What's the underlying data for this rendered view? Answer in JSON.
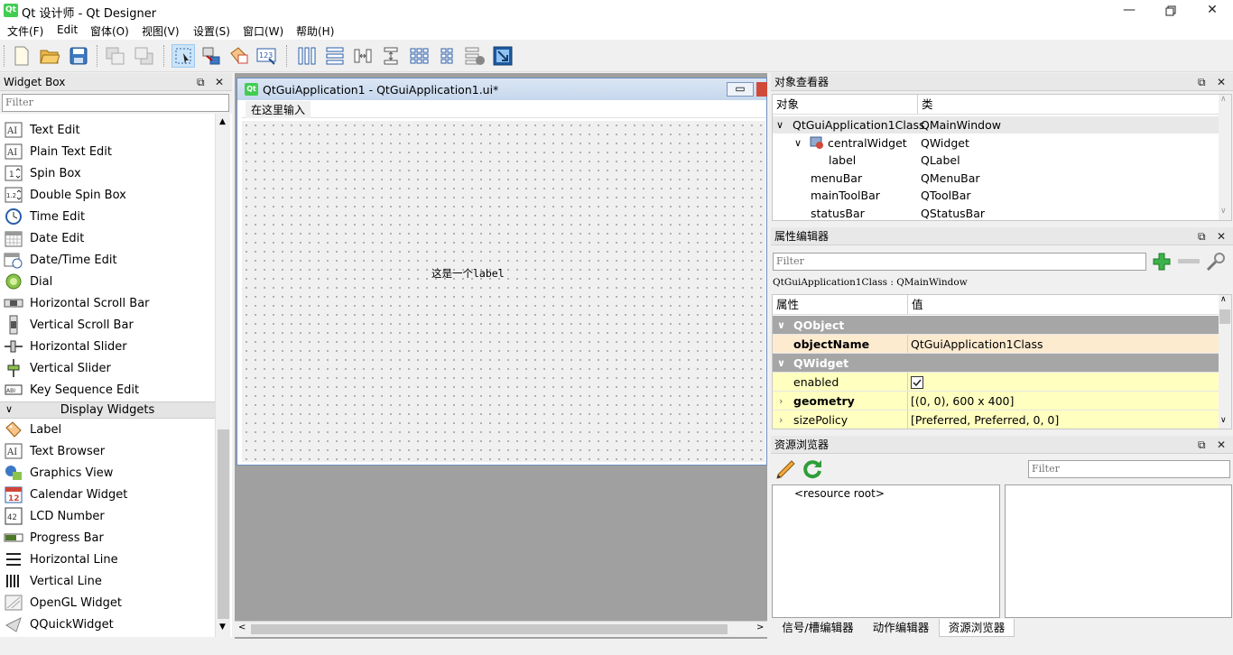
{
  "window": {
    "title": "Qt 设计师 - Qt Designer",
    "logo": "Qt"
  },
  "menubar": [
    "文件(F)",
    "Edit",
    "窗体(O)",
    "视图(V)",
    "设置(S)",
    "窗口(W)",
    "帮助(H)"
  ],
  "widget_box": {
    "title": "Widget Box",
    "filter_placeholder": "Filter",
    "items_top": [
      {
        "label": "Text Edit",
        "icon": "text-edit-icon"
      },
      {
        "label": "Plain Text Edit",
        "icon": "plain-text-edit-icon"
      },
      {
        "label": "Spin Box",
        "icon": "spin-box-icon"
      },
      {
        "label": "Double Spin Box",
        "icon": "double-spin-box-icon"
      },
      {
        "label": "Time Edit",
        "icon": "clock-icon"
      },
      {
        "label": "Date Edit",
        "icon": "calendar-grid-icon"
      },
      {
        "label": "Date/Time Edit",
        "icon": "calendar-clock-icon"
      },
      {
        "label": "Dial",
        "icon": "dial-icon"
      },
      {
        "label": "Horizontal Scroll Bar",
        "icon": "hscrollbar-icon"
      },
      {
        "label": "Vertical Scroll Bar",
        "icon": "vscrollbar-icon"
      },
      {
        "label": "Horizontal Slider",
        "icon": "hslider-icon"
      },
      {
        "label": "Vertical Slider",
        "icon": "vslider-icon"
      },
      {
        "label": "Key Sequence Edit",
        "icon": "key-sequence-icon"
      }
    ],
    "category": "Display Widgets",
    "items_bottom": [
      {
        "label": "Label",
        "icon": "label-tag-icon"
      },
      {
        "label": "Text Browser",
        "icon": "text-browser-icon"
      },
      {
        "label": "Graphics View",
        "icon": "graphics-view-icon"
      },
      {
        "label": "Calendar Widget",
        "icon": "calendar-icon",
        "badge": "12"
      },
      {
        "label": "LCD Number",
        "icon": "lcd-number-icon",
        "badge": "42"
      },
      {
        "label": "Progress Bar",
        "icon": "progress-bar-icon"
      },
      {
        "label": "Horizontal Line",
        "icon": "hline-icon"
      },
      {
        "label": "Vertical Line",
        "icon": "vline-icon"
      },
      {
        "label": "OpenGL Widget",
        "icon": "opengl-icon"
      },
      {
        "label": "QQuickWidget",
        "icon": "quick-widget-icon"
      }
    ]
  },
  "form_window": {
    "title": "QtGuiApplication1 - QtGuiApplication1.ui*",
    "logo": "Qt",
    "menu_placeholder": "在这里输入",
    "label_text": "这是一个label"
  },
  "object_inspector": {
    "title": "对象查看器",
    "headers": [
      "对象",
      "类"
    ],
    "rows": [
      {
        "object": "QtGuiApplication1Class",
        "class": "QMainWindow",
        "level": 0,
        "expander": "∨"
      },
      {
        "object": "centralWidget",
        "class": "QWidget",
        "level": 1,
        "expander": "∨"
      },
      {
        "object": "label",
        "class": "QLabel",
        "level": 2,
        "expander": ""
      },
      {
        "object": "menuBar",
        "class": "QMenuBar",
        "level": 1,
        "expander": ""
      },
      {
        "object": "mainToolBar",
        "class": "QToolBar",
        "level": 1,
        "expander": ""
      },
      {
        "object": "statusBar",
        "class": "QStatusBar",
        "level": 1,
        "expander": ""
      }
    ]
  },
  "property_editor": {
    "title": "属性编辑器",
    "filter_placeholder": "Filter",
    "context": "QtGuiApplication1Class : QMainWindow",
    "headers": [
      "属性",
      "值"
    ],
    "rows": [
      {
        "name": "QObject",
        "value": "",
        "kind": "category"
      },
      {
        "name": "objectName",
        "value": "QtGuiApplication1Class",
        "kind": "bold"
      },
      {
        "name": "QWidget",
        "value": "",
        "kind": "category"
      },
      {
        "name": "enabled",
        "value": "",
        "kind": "checkbox"
      },
      {
        "name": "geometry",
        "value": "[(0, 0), 600 x 400]",
        "kind": "bold-expand"
      },
      {
        "name": "sizePolicy",
        "value": "[Preferred, Preferred, 0, 0]",
        "kind": "expand"
      }
    ]
  },
  "resource_browser": {
    "title": "资源浏览器",
    "filter_placeholder": "Filter",
    "root": "<resource root>"
  },
  "bottom_tabs": [
    "信号/槽编辑器",
    "动作编辑器",
    "资源浏览器"
  ],
  "colors": {
    "accent_green": "#41cd52",
    "selection": "#cce4f7",
    "category_bg": "#a6a6a6",
    "objectname_bg": "#fdebd0",
    "widget_prop_bg": "#ffffc0"
  }
}
